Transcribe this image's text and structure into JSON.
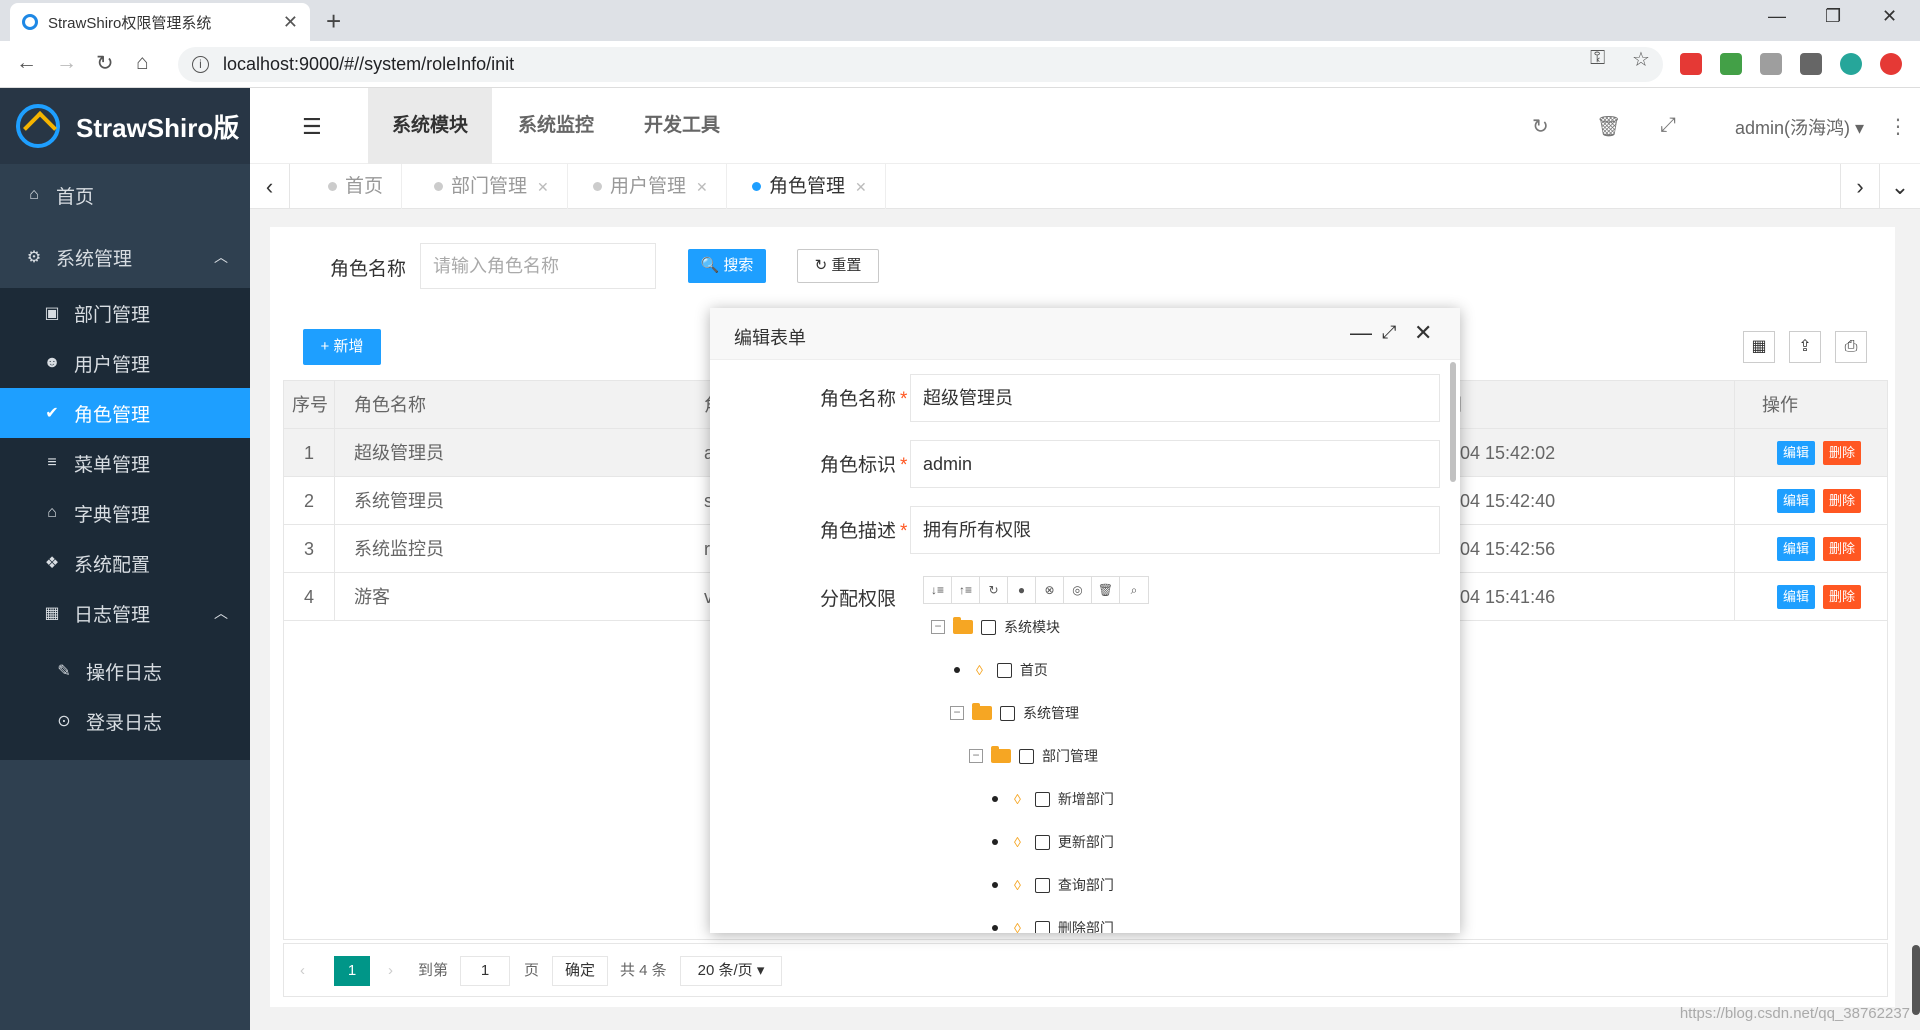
{
  "browser": {
    "tab_title": "StrawShiro权限管理系统",
    "tab_close": "✕",
    "new_tab": "+",
    "url": "localhost:9000/#//system/roleInfo/init"
  },
  "app": {
    "logo_text": "StrawShiro版"
  },
  "sidebar": {
    "home": "首页",
    "system_mgmt": "系统管理",
    "items": [
      {
        "label": "部门管理",
        "icon": "id-card-icon"
      },
      {
        "label": "用户管理",
        "icon": "users-icon"
      },
      {
        "label": "角色管理",
        "icon": "check-icon"
      },
      {
        "label": "菜单管理",
        "icon": "list-icon"
      },
      {
        "label": "字典管理",
        "icon": "graduation-cap-icon"
      },
      {
        "label": "系统配置",
        "icon": "cubes-icon"
      }
    ],
    "log_mgmt": "日志管理",
    "log_items": [
      {
        "label": "操作日志",
        "icon": "wrench-icon"
      },
      {
        "label": "登录日志",
        "icon": "login-icon"
      }
    ]
  },
  "header": {
    "tabs": [
      "系统模块",
      "系统监控",
      "开发工具"
    ],
    "user": "admin(汤海鸿)"
  },
  "page_tabs": [
    {
      "label": "首页"
    },
    {
      "label": "部门管理"
    },
    {
      "label": "用户管理"
    },
    {
      "label": "角色管理"
    }
  ],
  "search": {
    "label": "角色名称",
    "placeholder": "请输入角色名称",
    "search_btn": "搜索",
    "reset_btn": "重置"
  },
  "toolbar": {
    "add_btn": "新增"
  },
  "table": {
    "headers": {
      "index": "序号",
      "name": "角色名称",
      "col3": "角",
      "time": "间",
      "ops": "操作"
    },
    "rows": [
      {
        "index": "1",
        "name": "超级管理员",
        "col3": "a",
        "time": "4-04 15:42:02"
      },
      {
        "index": "2",
        "name": "系统管理员",
        "col3": "s",
        "time": "4-04 15:42:40"
      },
      {
        "index": "3",
        "name": "系统监控员",
        "col3": "r",
        "time": "4-04 15:42:56"
      },
      {
        "index": "4",
        "name": "游客",
        "col3": "v",
        "time": "4-04 15:41:46"
      }
    ],
    "edit_label": "编辑",
    "delete_label": "删除"
  },
  "pager": {
    "current": "1",
    "goto_label": "到第",
    "goto_value": "1",
    "page_label": "页",
    "confirm": "确定",
    "total": "共 4 条",
    "page_size": "20 条/页"
  },
  "dialog": {
    "title": "编辑表单",
    "fields": [
      {
        "label": "角色名称",
        "value": "超级管理员"
      },
      {
        "label": "角色标识",
        "value": "admin"
      },
      {
        "label": "角色描述",
        "value": "拥有所有权限"
      }
    ],
    "perm_label": "分配权限",
    "tree": [
      {
        "label": "系统模块"
      },
      {
        "label": "首页"
      },
      {
        "label": "系统管理"
      },
      {
        "label": "部门管理"
      },
      {
        "label": "新增部门"
      },
      {
        "label": "更新部门"
      },
      {
        "label": "查询部门"
      },
      {
        "label": "删除部门"
      }
    ]
  },
  "watermark": "https://blog.csdn.net/qq_38762237"
}
